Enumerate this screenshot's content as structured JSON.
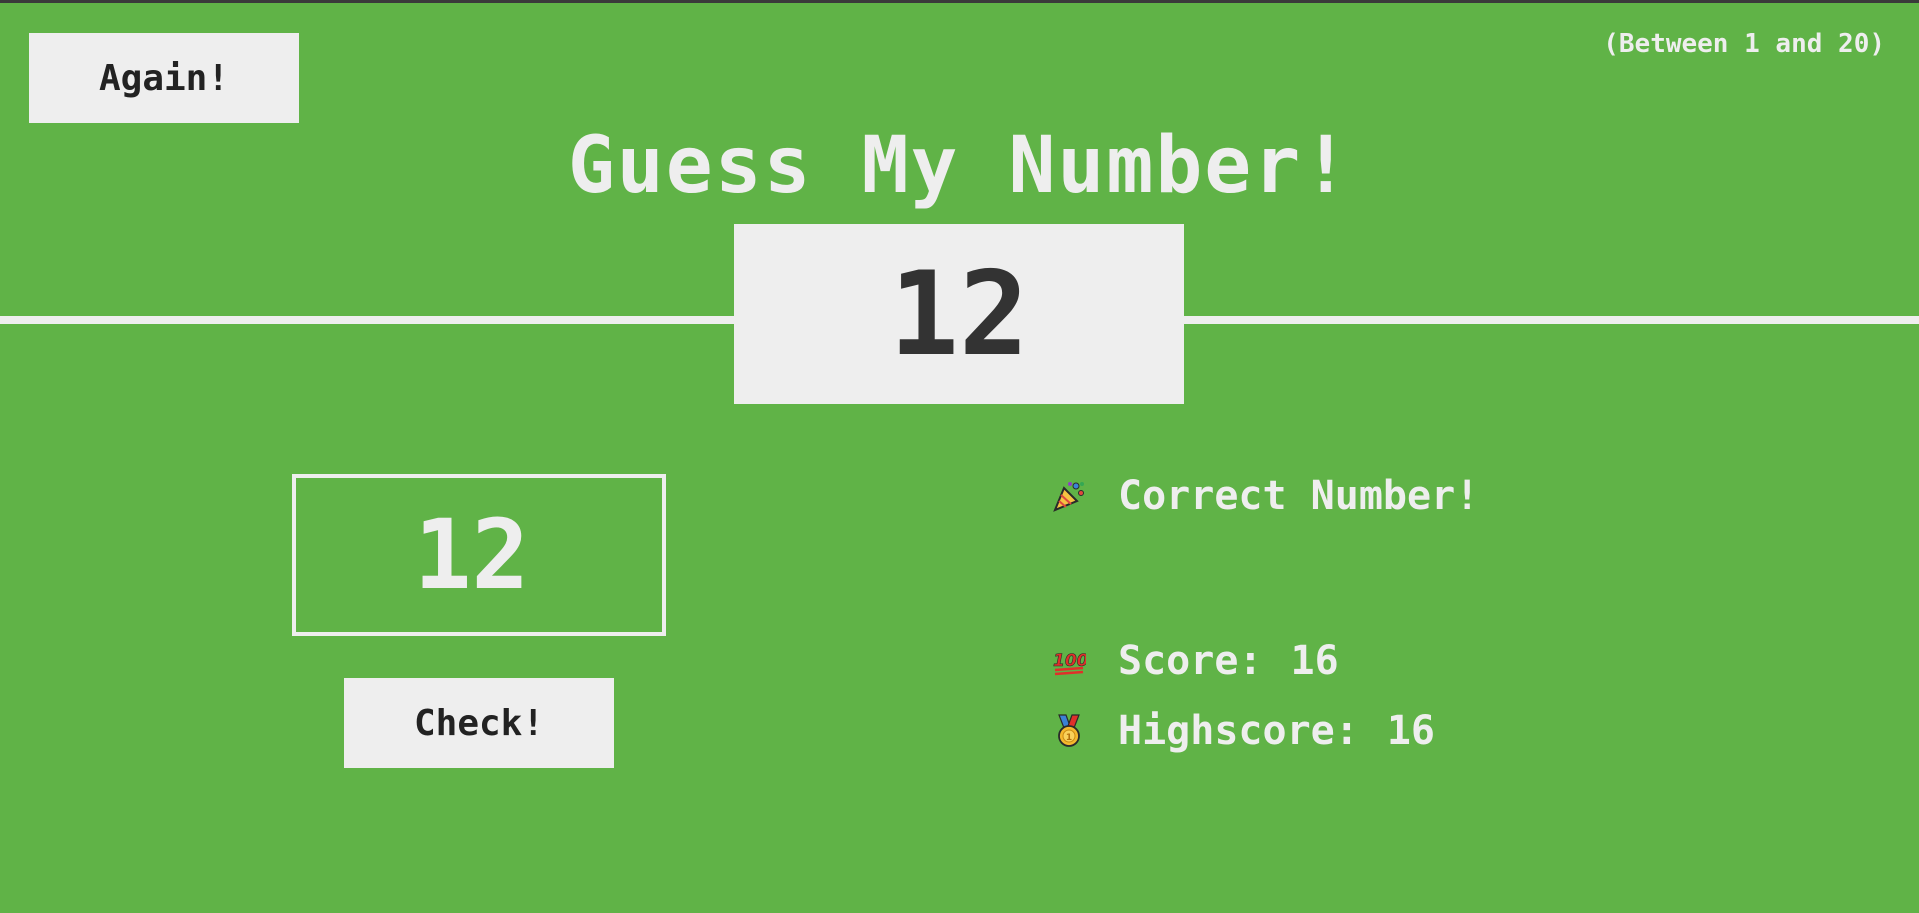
{
  "header": {
    "again_label": "Again!",
    "range_hint": "(Between 1 and 20)",
    "title": "Guess My Number!"
  },
  "secret": {
    "number": "12"
  },
  "guess": {
    "value": "12"
  },
  "controls": {
    "check_label": "Check!"
  },
  "stats": {
    "message": "Correct Number!",
    "score_label": "Score:",
    "score_value": "16",
    "highscore_label": "Highscore:",
    "highscore_value": "16"
  },
  "icons": {
    "message": "party-popper-icon",
    "score": "hundred-points-icon",
    "highscore": "medal-icon"
  },
  "colors": {
    "background_win": "#60b347",
    "foreground": "#eeeeee",
    "dark_text": "#333333"
  }
}
